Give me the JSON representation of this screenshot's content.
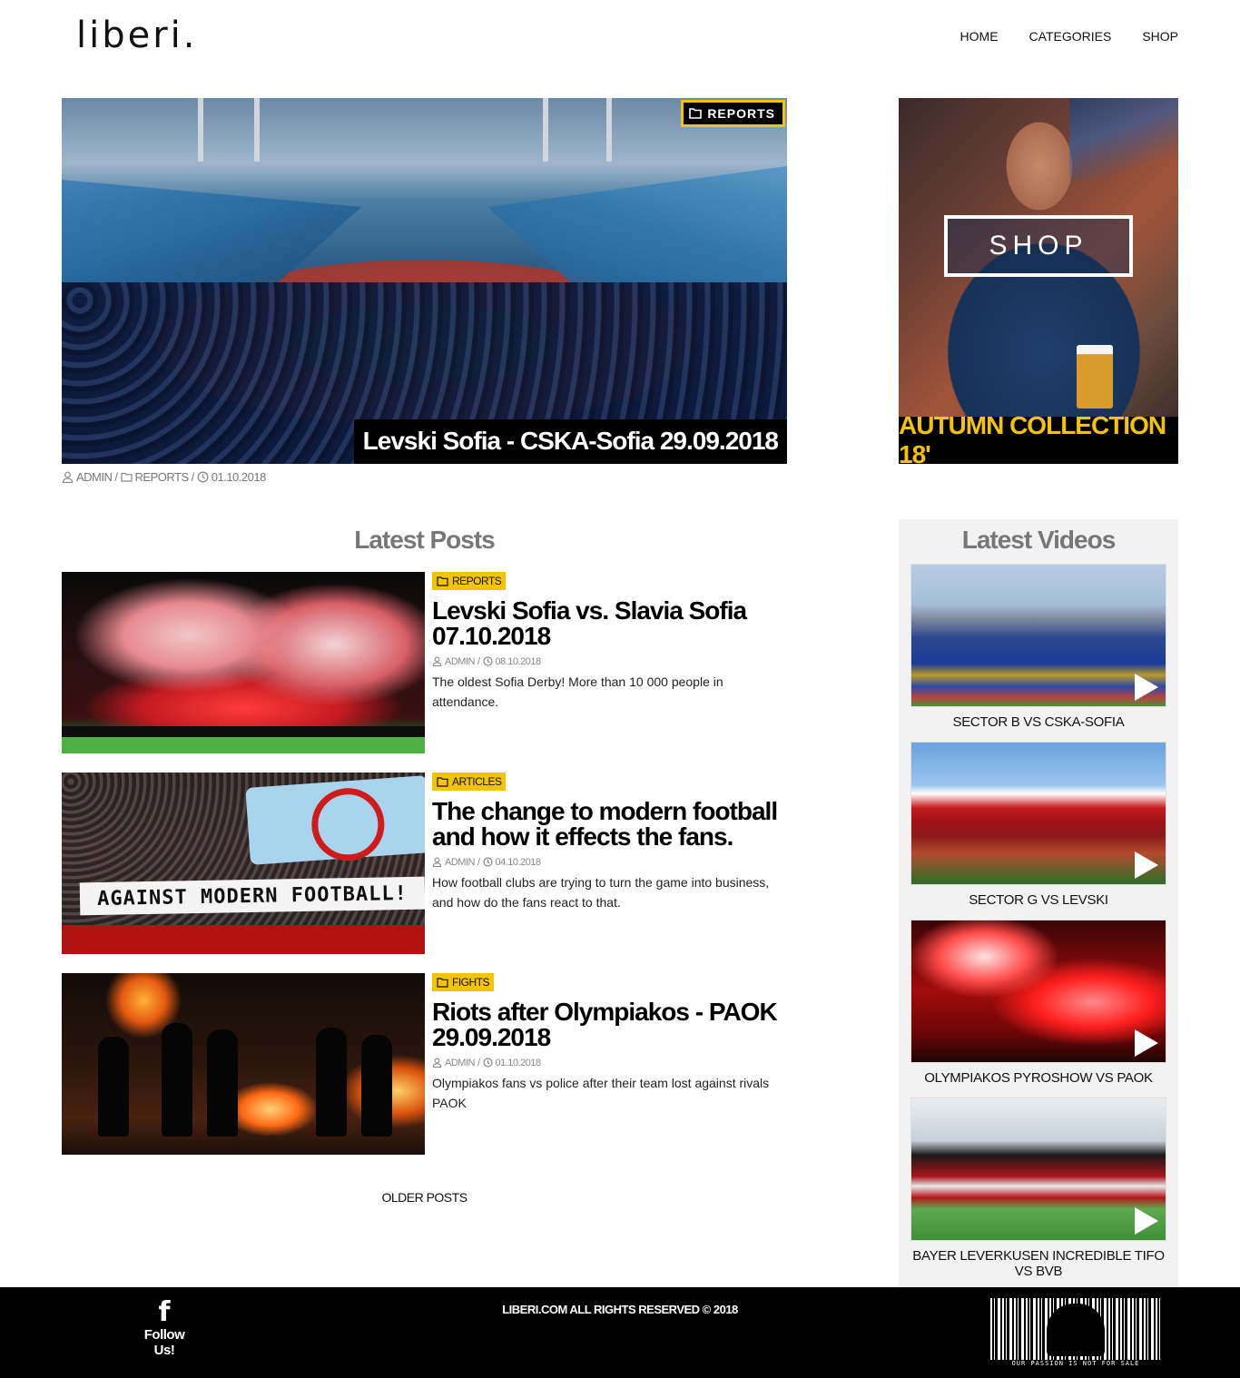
{
  "header": {
    "logo": "liberi.",
    "nav": [
      "HOME",
      "CATEGORIES",
      "SHOP"
    ]
  },
  "hero": {
    "category": "REPORTS",
    "title": "Levski Sofia - CSKA-Sofia 29.09.2018",
    "meta": {
      "author": "ADMIN",
      "category": "REPORTS",
      "date": "01.10.2018"
    }
  },
  "shop_banner": {
    "button": "SHOP",
    "collection": "AUTUMN COLLECTION 18'",
    "accent": "#f5c400"
  },
  "latest_posts": {
    "title": "Latest Posts",
    "posts": [
      {
        "category": "REPORTS",
        "title": "Levski Sofia vs. Slavia Sofia 07.10.2018",
        "author": "ADMIN",
        "date": "08.10.2018",
        "excerpt": "The oldest Sofia Derby! More than 10 000 people in attendance."
      },
      {
        "category": "ARTICLES",
        "title": "The change to modern football and how it effects the fans.",
        "author": "ADMIN",
        "date": "04.10.2018",
        "excerpt": "How football clubs are trying to turn the game into business, and how do the fans react to that.",
        "image_text": "AGAINST MODERN FOOTBALL!"
      },
      {
        "category": "FIGHTS",
        "title": "Riots after Olympiakos - PAOK 29.09.2018",
        "author": "ADMIN",
        "date": "01.10.2018",
        "excerpt": "Olympiakos fans vs police after their team lost against rivals PAOK"
      }
    ],
    "older_posts": "OLDER POSTS"
  },
  "latest_videos": {
    "title": "Latest Videos",
    "videos": [
      {
        "label": "SECTOR B VS CSKA-SOFIA"
      },
      {
        "label": "SECTOR G VS LEVSKI"
      },
      {
        "label": "OLYMPIAKOS PYROSHOW VS PAOK"
      },
      {
        "label": "BAYER LEVERKUSEN INCREDIBLE TIFO VS BVB"
      }
    ]
  },
  "footer": {
    "facebook_icon": "f",
    "follow": "Follow Us!",
    "copyright": "LIBERI.COM ALL RIGHTS RESERVED © 2018",
    "barcode_motto": "OUR PASSION IS NOT FOR SALE"
  },
  "icons": {
    "folder": "folder-icon",
    "user": "user-icon",
    "clock": "clock-icon",
    "play": "play-icon",
    "facebook": "facebook-icon"
  }
}
